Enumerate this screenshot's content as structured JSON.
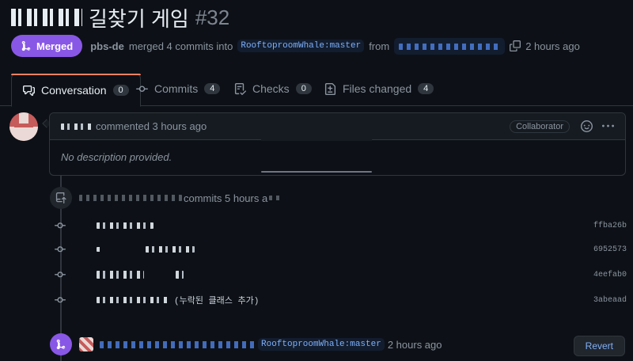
{
  "pr": {
    "title": "길찾기 게임",
    "number": "#32",
    "state": "Merged",
    "author": "pbs-de",
    "merged_text": "merged 4 commits into",
    "base_branch": "RooftoproomWhale:master",
    "from_text": "from",
    "time": "2 hours ago"
  },
  "tabs": [
    {
      "label": "Conversation",
      "count": "0"
    },
    {
      "label": "Commits",
      "count": "4"
    },
    {
      "label": "Checks",
      "count": "0"
    },
    {
      "label": "Files changed",
      "count": "4"
    }
  ],
  "comment": {
    "action": "commented 3 hours ago",
    "role": "Collaborator",
    "body": "No description provided."
  },
  "commit_event": {
    "text": "commits 5 hours a"
  },
  "commits": [
    {
      "message": "",
      "sha": "ffba26b"
    },
    {
      "message": "",
      "sha": "6952573"
    },
    {
      "message": "",
      "sha": "4eefab0"
    },
    {
      "message": "(누락된 클래스 추가)",
      "sha": "3abeaad"
    }
  ],
  "merge_event": {
    "branch": "RooftoproomWhale:master",
    "time": "2 hours ago",
    "revert_label": "Revert"
  },
  "colors": {
    "background": "#0d1117",
    "merged": "#8957e5",
    "link": "#7fb0f8",
    "tab_underline": "#f78166"
  }
}
